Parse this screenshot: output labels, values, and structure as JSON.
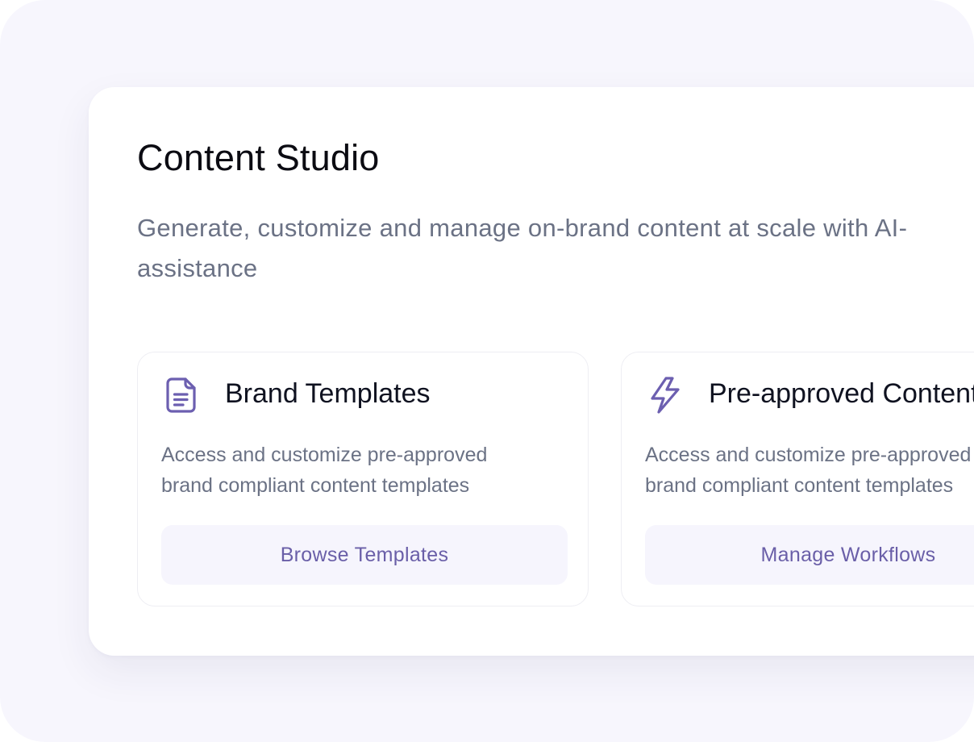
{
  "header": {
    "title": "Content Studio",
    "subtitle": "Generate, customize and manage on-brand content at scale with AI- assistance"
  },
  "cards": [
    {
      "icon": "document-icon",
      "title": "Brand Templates",
      "description_line1": "Access and customize pre-approved",
      "description_line2": "brand compliant content templates",
      "button_label": "Browse Templates"
    },
    {
      "icon": "lightning-icon",
      "title": "Pre-approved Content",
      "description_line1": "Access and customize pre-approved",
      "description_line2": "brand compliant content templates",
      "button_label": "Manage Workflows"
    }
  ],
  "colors": {
    "accent": "#6a5fa8",
    "icon": "#6c5fb0",
    "backdrop": "#f7f6fd",
    "button_bg": "#f6f5fd",
    "muted_text": "#6b7285"
  }
}
